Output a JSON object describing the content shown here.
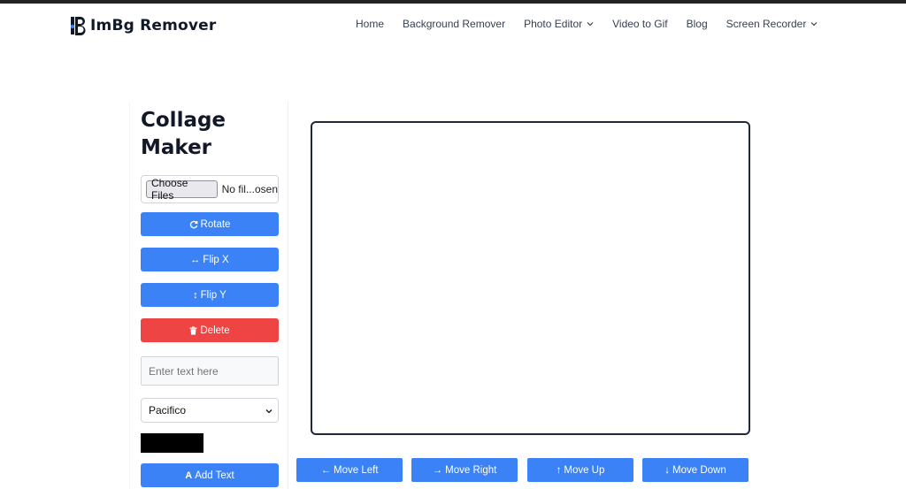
{
  "brand": {
    "name": "ImBg Remover",
    "accent": "#3b82f6"
  },
  "nav": {
    "items": [
      {
        "label": "Home",
        "dropdown": false
      },
      {
        "label": "Background Remover",
        "dropdown": false
      },
      {
        "label": "Photo Editor",
        "dropdown": true
      },
      {
        "label": "Video to Gif",
        "dropdown": false
      },
      {
        "label": "Blog",
        "dropdown": false
      },
      {
        "label": "Screen Recorder",
        "dropdown": true
      }
    ]
  },
  "sidebar": {
    "title": "Collage Maker",
    "file_button": "Choose Files",
    "file_status": "No fil...osen",
    "rotate": {
      "icon": "rotate-icon",
      "label": "Rotate"
    },
    "flip_x": {
      "icon": "horizontal-arrows-icon",
      "label": "Flip X"
    },
    "flip_y": {
      "icon": "vertical-arrows-icon",
      "label": "Flip Y"
    },
    "delete": {
      "icon": "trash-icon",
      "label": "Delete",
      "color": "#ef4444"
    },
    "text_placeholder": "Enter text here",
    "font_selected": "Pacifico",
    "text_color": "#000000",
    "add_text": {
      "icon": "font-icon",
      "label": "Add Text"
    }
  },
  "controls": {
    "move_left": "Move Left",
    "move_right": "Move Right",
    "move_up": "Move Up",
    "move_down": "Move Down"
  }
}
